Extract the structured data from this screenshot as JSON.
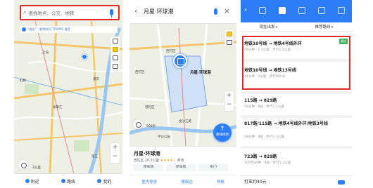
{
  "map1": {
    "search_placeholder": "查找地点、公交、地铁",
    "ticker_text": "“酒店”：限免时间 TFBOYS 语音",
    "labels": [
      "上海",
      "虹桥",
      "徐家汇",
      "浦东",
      "张江"
    ],
    "scale": "2公里",
    "nav": [
      "附近",
      "路线",
      "我的"
    ]
  },
  "map2": {
    "title": "月星·环球港",
    "labels": [
      "西钉区",
      "西钉区",
      "月星·环球港",
      "普陀区",
      "金沙江路",
      "中山公园"
    ],
    "scale": "500米",
    "route_button": "路线规划",
    "poi": {
      "name": "月星·环球港",
      "meta": "普陀区  10.2公里",
      "stars": "★★★★☆",
      "tag": "商场",
      "chips": [
        "停车场",
        "停车场",
        "东门"
      ],
      "actions": [
        "室内导览",
        "搜周边",
        "导航"
      ]
    }
  },
  "routes": {
    "filters": [
      "现在出发",
      "推荐路线"
    ],
    "items": [
      {
        "lines": "地铁10号线 → 地铁4号线外环",
        "meta": "44分钟 · 1.2公里 · 步行1.2公里",
        "badge": "最快"
      },
      {
        "lines": "地铁10号线 → 地铁13号线",
        "meta": "44分钟 · 2公里 · 步行965米"
      },
      {
        "lines": "115路 → 829路",
        "meta": "58分钟 · 8站 · 步行1.1公里"
      },
      {
        "lines": "817路/115路 → 地铁4号线外环/地铁3号线",
        "meta": "58分钟 · 8站 · 步行1.2公里"
      },
      {
        "lines": "723路 → 829路",
        "meta": "1小时5分钟 · 8站 · 步行1.2公里"
      }
    ],
    "taxi": "打车约40元"
  },
  "colors": {
    "accent": "#2d7df6",
    "highlight": "#e02a2a",
    "fast_badge": "#33b35a"
  }
}
